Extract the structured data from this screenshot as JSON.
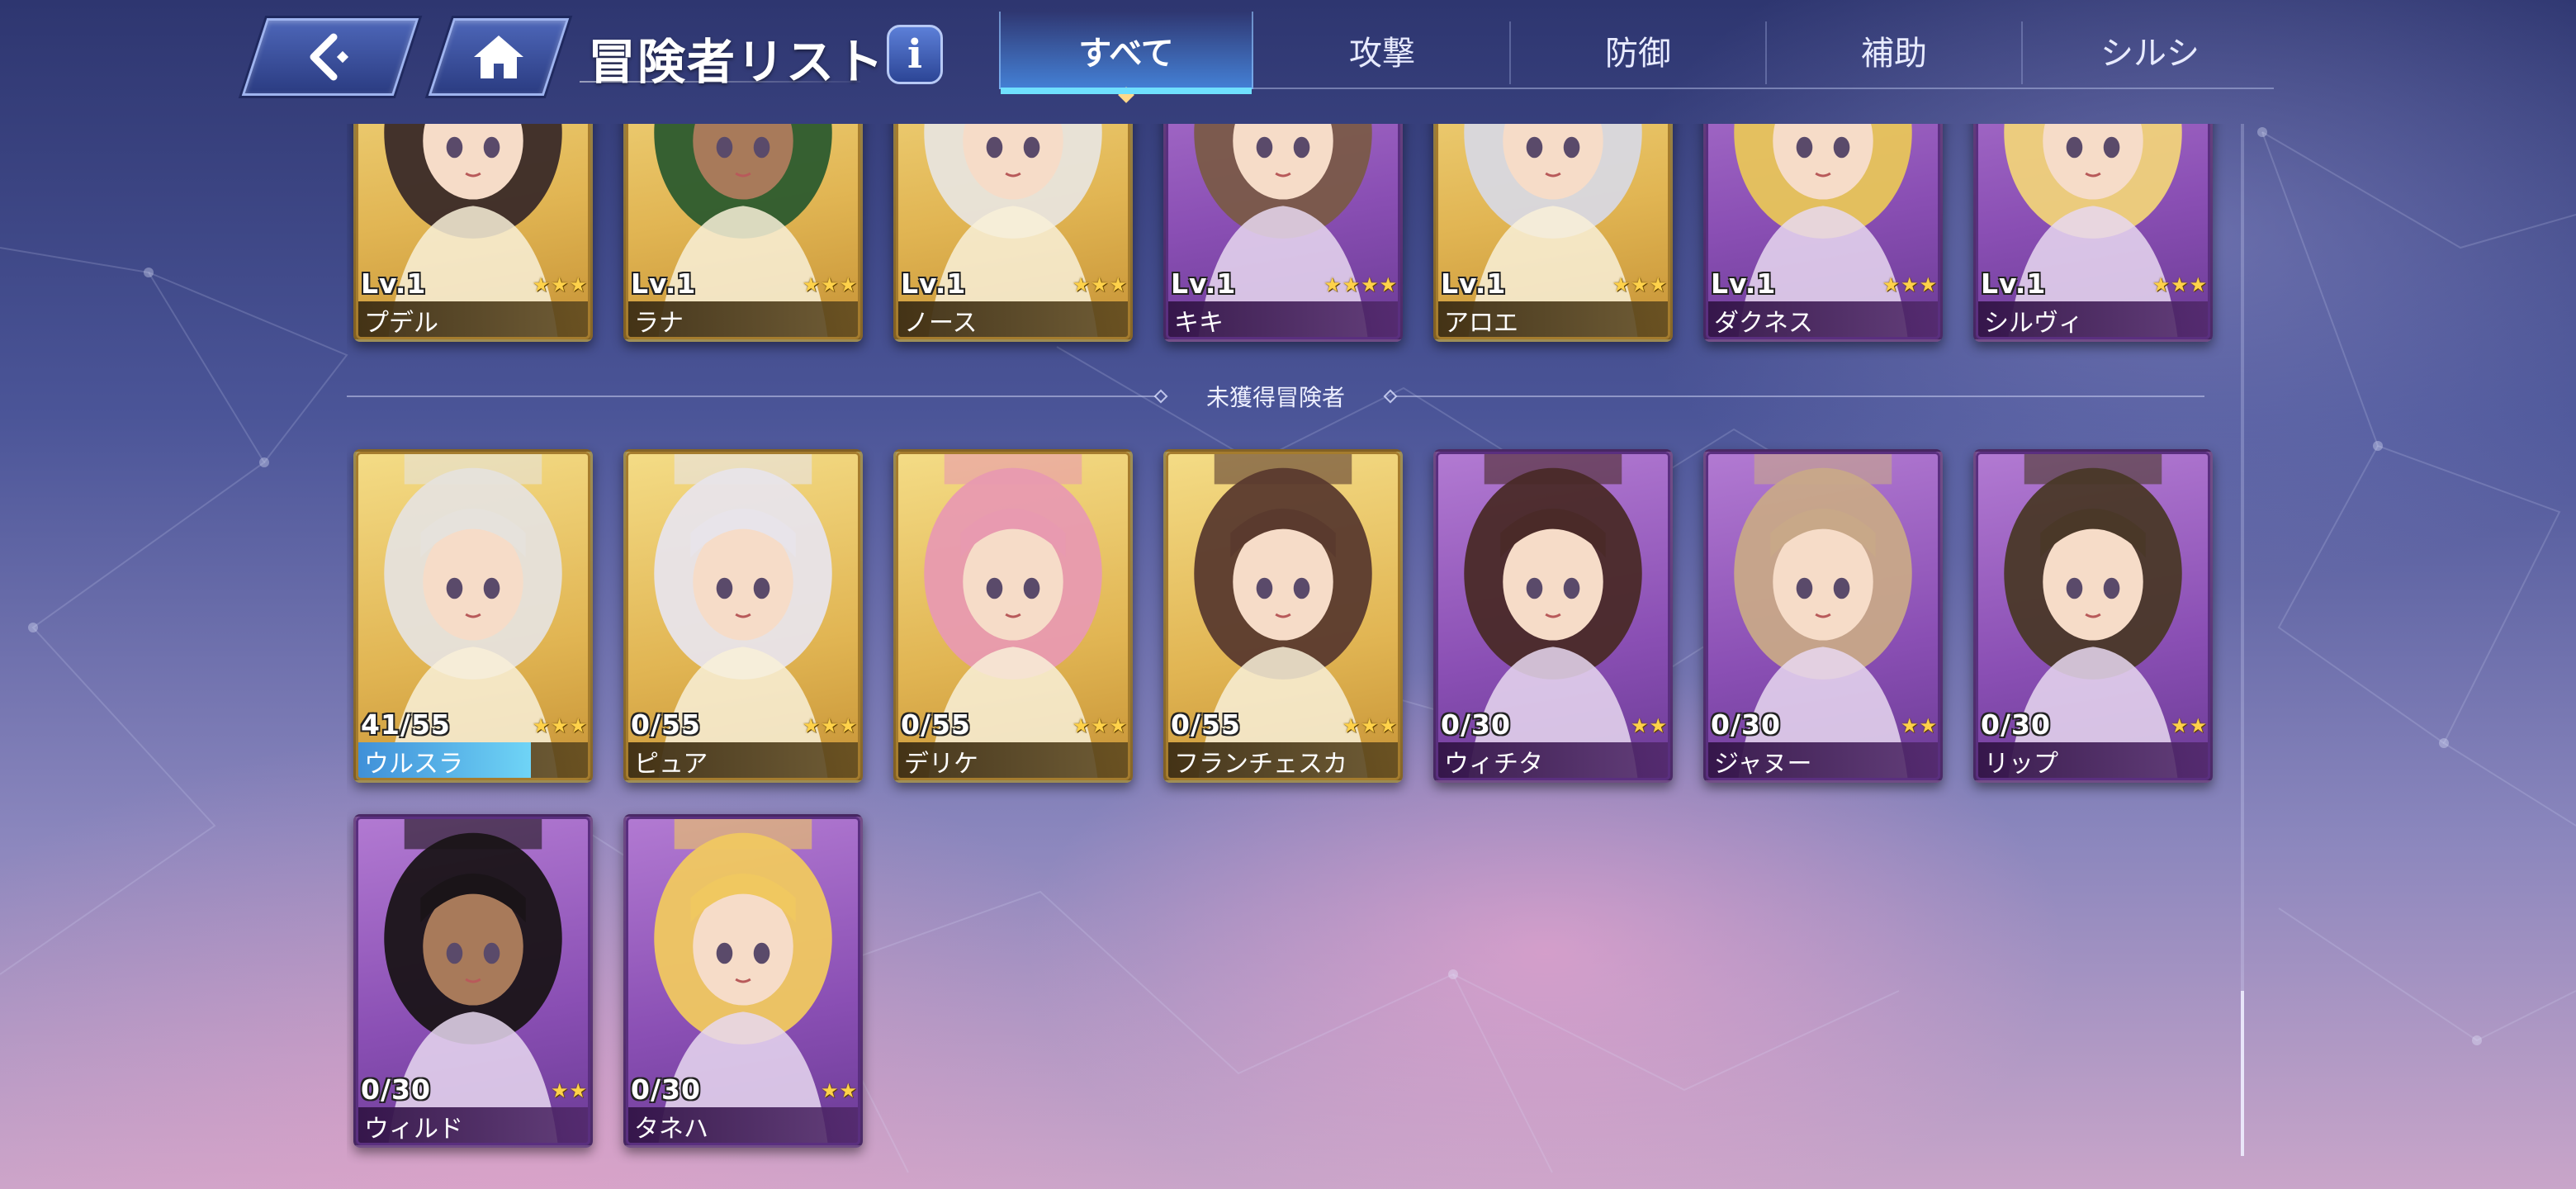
{
  "header": {
    "back_icon": "back-arrow-icon",
    "home_icon": "home-icon",
    "title": "冒険者リスト",
    "info_label": "i"
  },
  "tabs": [
    {
      "label": "すべて",
      "active": true
    },
    {
      "label": "攻撃",
      "active": false
    },
    {
      "label": "防御",
      "active": false
    },
    {
      "label": "補助",
      "active": false
    },
    {
      "label": "シルシ",
      "active": false
    }
  ],
  "owned": [
    {
      "level": "Lv.1",
      "name": "プデル",
      "stars": 3,
      "rarity": "gold"
    },
    {
      "level": "Lv.1",
      "name": "ラナ",
      "stars": 3,
      "rarity": "gold"
    },
    {
      "level": "Lv.1",
      "name": "ノース",
      "stars": 3,
      "rarity": "gold"
    },
    {
      "level": "Lv.1",
      "name": "キキ",
      "stars": 4,
      "rarity": "purple"
    },
    {
      "level": "Lv.1",
      "name": "アロエ",
      "stars": 3,
      "rarity": "gold"
    },
    {
      "level": "Lv.1",
      "name": "ダクネス",
      "stars": 3,
      "rarity": "purple"
    },
    {
      "level": "Lv.1",
      "name": "シルヴィ",
      "stars": 3,
      "rarity": "purple"
    }
  ],
  "divider_label": "未獲得冒険者",
  "unobtained": [
    {
      "progress": "41/55",
      "fraction": 0.745,
      "name": "ウルスラ",
      "stars": 3,
      "rarity": "gold"
    },
    {
      "progress": "0/55",
      "fraction": 0,
      "name": "ピュア",
      "stars": 3,
      "rarity": "gold"
    },
    {
      "progress": "0/55",
      "fraction": 0,
      "name": "デリケ",
      "stars": 3,
      "rarity": "gold"
    },
    {
      "progress": "0/55",
      "fraction": 0,
      "name": "フランチェスカ",
      "stars": 3,
      "rarity": "gold"
    },
    {
      "progress": "0/30",
      "fraction": 0,
      "name": "ウィチタ",
      "stars": 2,
      "rarity": "purple"
    },
    {
      "progress": "0/30",
      "fraction": 0,
      "name": "ジャヌー",
      "stars": 2,
      "rarity": "purple"
    },
    {
      "progress": "0/30",
      "fraction": 0,
      "name": "リップ",
      "stars": 2,
      "rarity": "purple"
    },
    {
      "progress": "0/30",
      "fraction": 0,
      "name": "ウィルド",
      "stars": 2,
      "rarity": "purple"
    },
    {
      "progress": "0/30",
      "fraction": 0,
      "name": "タネハ",
      "stars": 2,
      "rarity": "purple"
    }
  ],
  "colors": {
    "gold_card": "#e1b553",
    "purple_card": "#8a4fb4",
    "active_tab": "#468ce6",
    "progress_fill": "#6fd4f6",
    "star": "#ffd24a"
  },
  "scroll": {
    "position": 1.0
  }
}
